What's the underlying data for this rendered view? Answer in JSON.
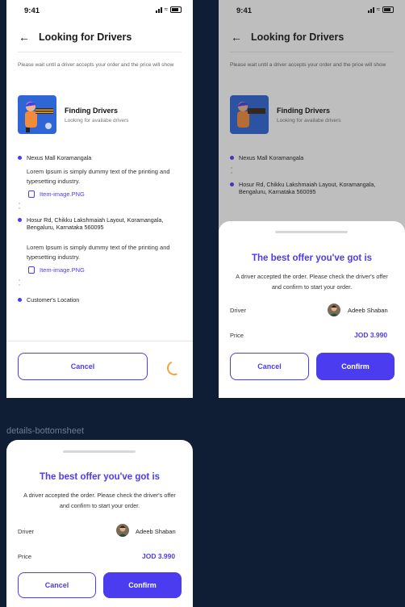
{
  "status_time": "9:41",
  "header": {
    "title": "Looking for Drivers"
  },
  "note": "Please wait until a driver accepts your order and the price will show",
  "finding": {
    "title": "Finding Drivers",
    "subtitle": "Looking for availabe drivers"
  },
  "locations": [
    {
      "title": "Nexus Mall Koramangala",
      "description": "Lorem Ipsum is simply dummy text of the printing and typesetting industry.",
      "attachment": "Item-image.PNG"
    },
    {
      "title": "Hosur Rd, Chikku Lakshmaiah Layout, Koramangala, Bengaluru, Karnataka 560095",
      "description": "Lorem Ipsum is simply dummy text of the printing and typesetting industry.",
      "attachment": "Item-image.PNG"
    },
    {
      "title": "Customer's Location"
    }
  ],
  "buttons": {
    "cancel": "Cancel",
    "confirm": "Confirm"
  },
  "offer": {
    "title": "The best offer you've got is",
    "description": "A driver accepted the order. Please check the driver's offer and confirm to start your order.",
    "driver_label": "Driver",
    "driver_name": "Adeeb Shaban",
    "price_label": "Price",
    "price_value": "JOD 3.990"
  },
  "caption": "details-bottomsheet",
  "colors": {
    "accent": "#4b3cf0",
    "spinner": "#f5a23a",
    "background": "#0f1e35"
  }
}
